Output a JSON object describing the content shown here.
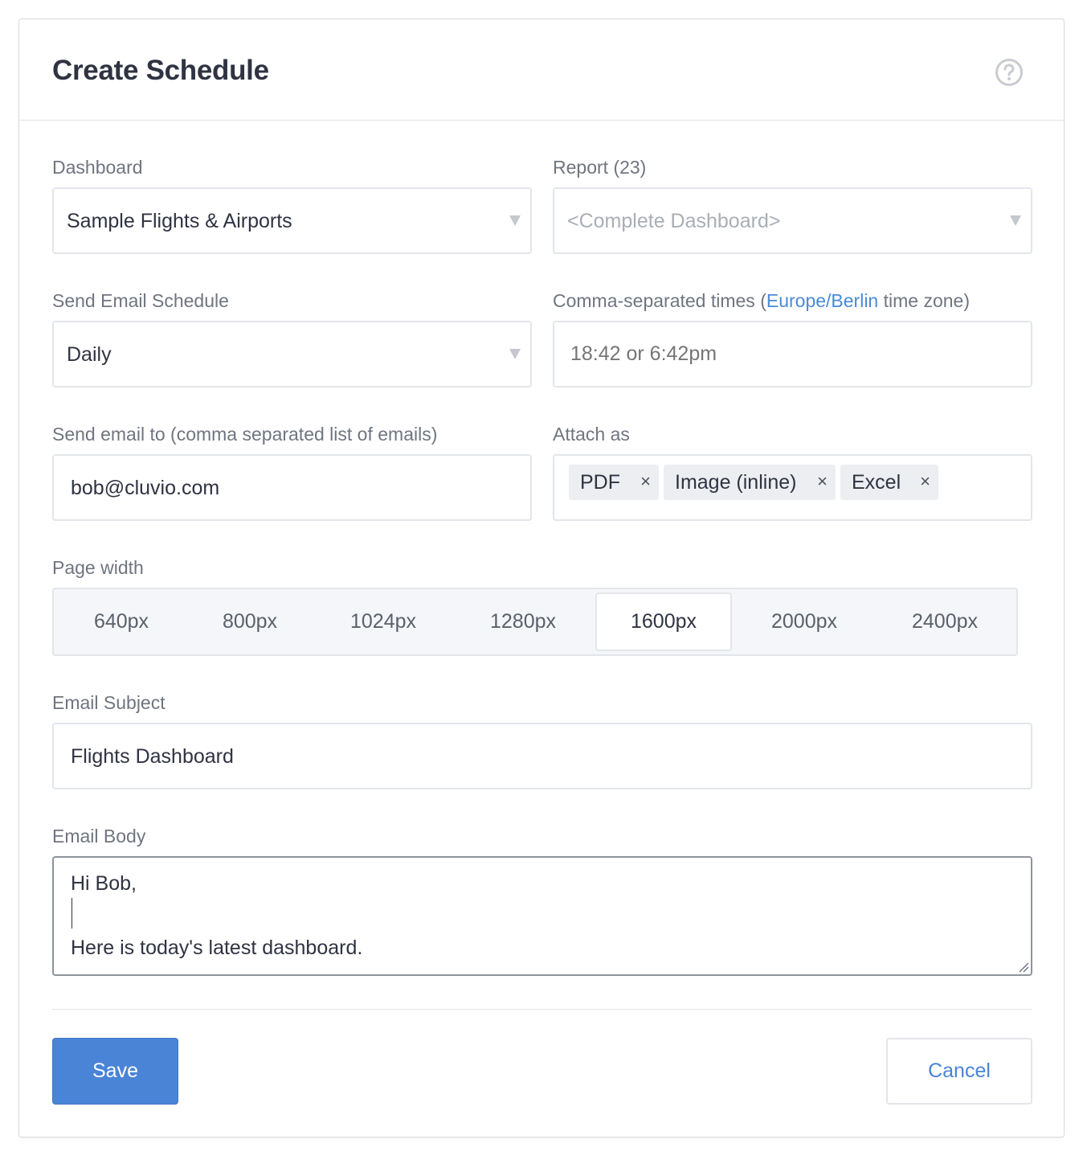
{
  "header": {
    "title": "Create Schedule",
    "help_icon": "question-circle-icon"
  },
  "dashboard": {
    "label": "Dashboard",
    "value": "Sample Flights & Airports"
  },
  "report": {
    "label_prefix": "Report",
    "label_count": "(23)",
    "placeholder": "<Complete Dashboard>"
  },
  "schedule": {
    "label": "Send Email Schedule",
    "value": "Daily"
  },
  "times": {
    "label_before": "Comma-separated times (",
    "timezone": "Europe/Berlin",
    "label_after": " time zone)",
    "placeholder": "18:42 or 6:42pm"
  },
  "recipients": {
    "label": "Send email to (comma separated list of emails)",
    "value": "bob@cluvio.com"
  },
  "attach": {
    "label": "Attach as",
    "tags": [
      {
        "label": "PDF",
        "remove": "×"
      },
      {
        "label": "Image (inline)",
        "remove": "×"
      },
      {
        "label": "Excel",
        "remove": "×"
      }
    ]
  },
  "page_width": {
    "label": "Page width",
    "options": [
      "640px",
      "800px",
      "1024px",
      "1280px",
      "1600px",
      "2000px",
      "2400px"
    ],
    "selected": "1600px"
  },
  "subject": {
    "label": "Email Subject",
    "value": "Flights Dashboard"
  },
  "body": {
    "label": "Email Body",
    "lines": [
      "Hi Bob,",
      "",
      "Here is today's latest dashboard."
    ]
  },
  "footer": {
    "save_label": "Save",
    "cancel_label": "Cancel"
  },
  "colors": {
    "accent": "#4a84d6",
    "link": "#4a8ad7",
    "text": "#2f3342",
    "muted": "#6f7580"
  }
}
